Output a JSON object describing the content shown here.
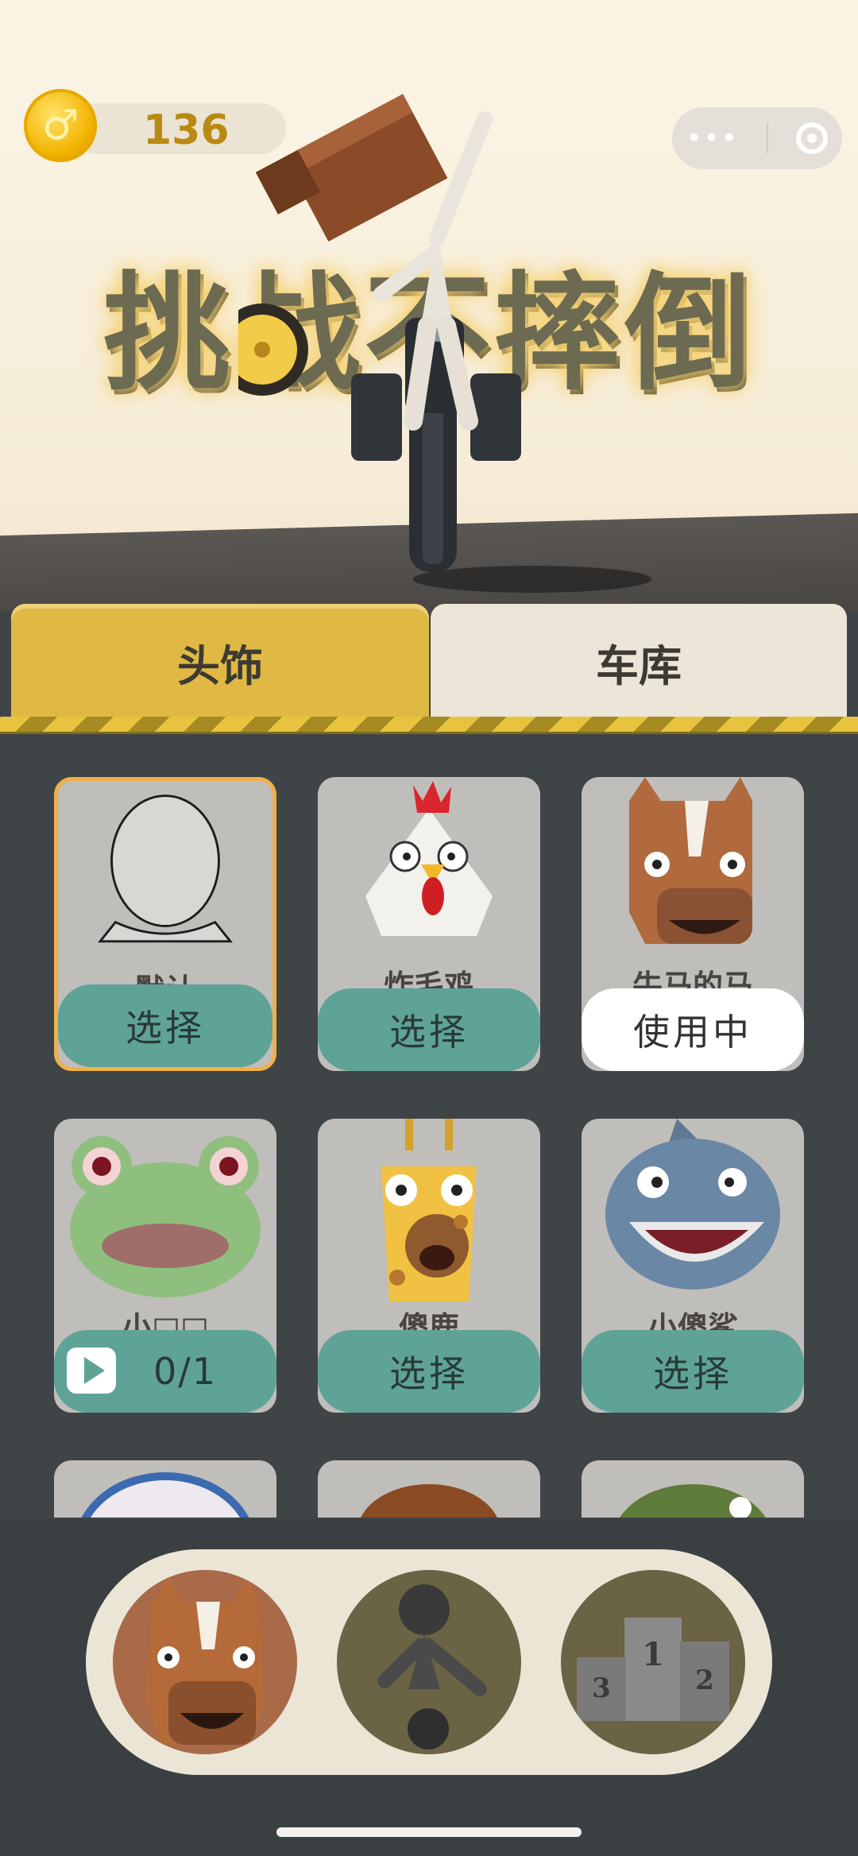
{
  "hud": {
    "coins": "136",
    "coin_icon": "coin-icon"
  },
  "title": "挑战不摔倒",
  "tabs": [
    {
      "label": "头饰",
      "active": true
    },
    {
      "label": "车库",
      "active": false
    }
  ],
  "items": [
    {
      "name": "默认",
      "action": "选择",
      "state": "select"
    },
    {
      "name": "炸毛鸡",
      "action": "选择",
      "state": "select"
    },
    {
      "name": "牛马的马",
      "action": "使用中",
      "state": "using"
    },
    {
      "name": "小□□",
      "action": "0/1",
      "state": "ad"
    },
    {
      "name": "傻鹿",
      "action": "选择",
      "state": "select"
    },
    {
      "name": "小傻鲨",
      "action": "选择",
      "state": "select"
    }
  ],
  "nav": {
    "items": [
      "headwear",
      "character",
      "leaderboard"
    ],
    "icons": [
      "horse-head-icon",
      "rider-icon",
      "podium-icon"
    ]
  },
  "colors": {
    "tab_active": "#dfb944",
    "tab_inactive": "#ece6d8",
    "button": "#5fa397",
    "card": "#c0bebb",
    "panel": "#3f4446"
  }
}
